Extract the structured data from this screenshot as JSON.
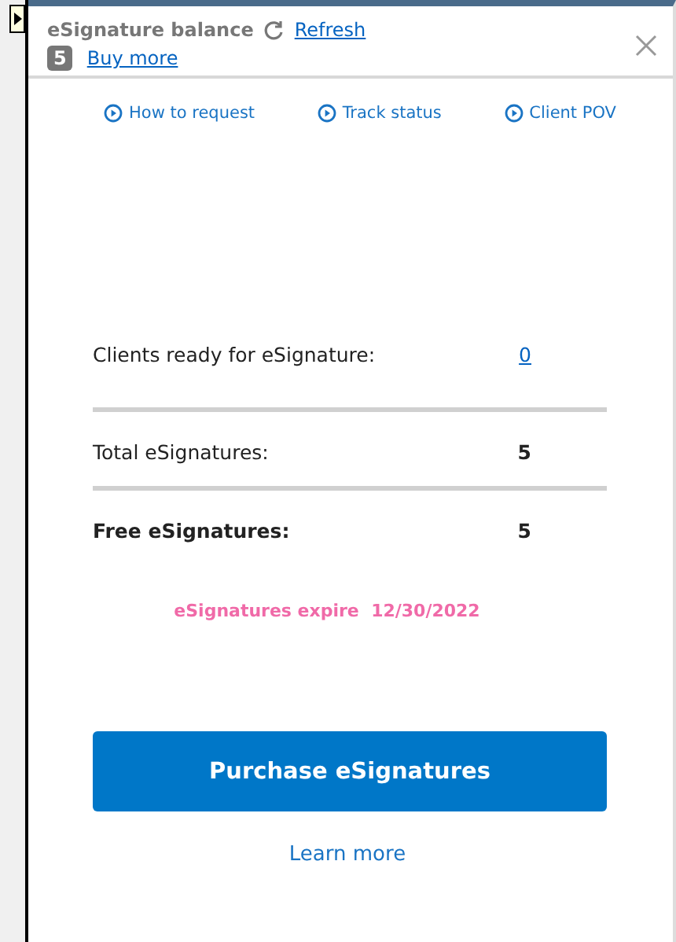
{
  "header": {
    "title": "eSignature balance",
    "refresh": "Refresh",
    "count": "5",
    "buy_more": "Buy more"
  },
  "video_links": [
    {
      "label": "How to request"
    },
    {
      "label": "Track status"
    },
    {
      "label": "Client POV"
    }
  ],
  "rows": [
    {
      "label": "Clients ready for eSignature:",
      "value": "0",
      "kind": "link",
      "bold_label": false
    },
    {
      "label": "Total eSignatures:",
      "value": "5",
      "kind": "plain",
      "bold_label": false
    },
    {
      "label": "Free eSignatures:",
      "value": "5",
      "kind": "plain",
      "bold_label": true
    }
  ],
  "expiry": {
    "label": "eSignatures expire",
    "date": "12/30/2022"
  },
  "purchase_button": "Purchase eSignatures",
  "learn_more": "Learn more"
}
